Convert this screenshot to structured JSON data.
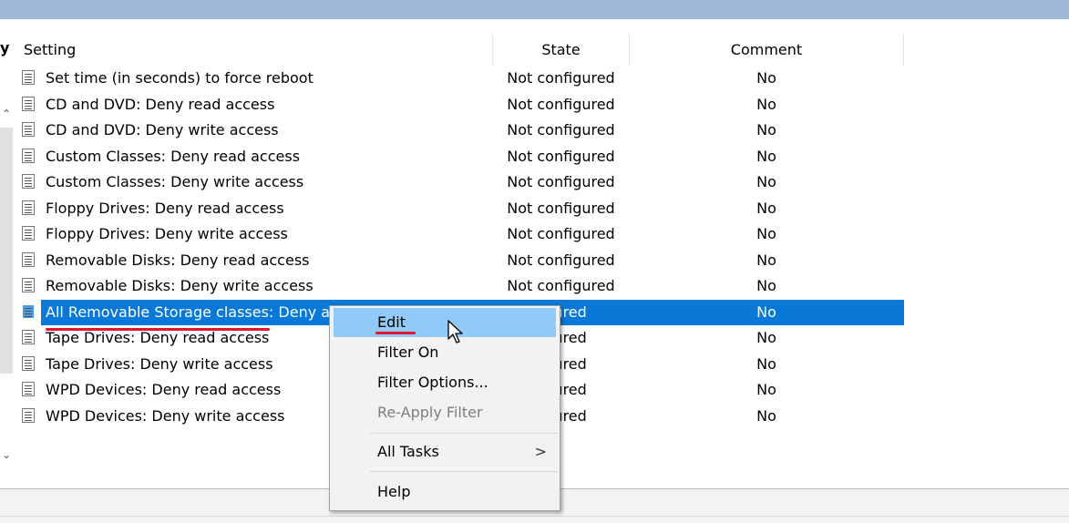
{
  "left_panel": {
    "partial_label": "y"
  },
  "columns": {
    "setting": "Setting",
    "state": "State",
    "comment": "Comment"
  },
  "rows": [
    {
      "setting": "Set time (in seconds) to force reboot",
      "state": "Not configured",
      "comment": "No"
    },
    {
      "setting": "CD and DVD: Deny read access",
      "state": "Not configured",
      "comment": "No"
    },
    {
      "setting": "CD and DVD: Deny write access",
      "state": "Not configured",
      "comment": "No"
    },
    {
      "setting": "Custom Classes: Deny read access",
      "state": "Not configured",
      "comment": "No"
    },
    {
      "setting": "Custom Classes: Deny write access",
      "state": "Not configured",
      "comment": "No"
    },
    {
      "setting": "Floppy Drives: Deny read access",
      "state": "Not configured",
      "comment": "No"
    },
    {
      "setting": "Floppy Drives: Deny write access",
      "state": "Not configured",
      "comment": "No"
    },
    {
      "setting": "Removable Disks: Deny read access",
      "state": "Not configured",
      "comment": "No"
    },
    {
      "setting": "Removable Disks: Deny write access",
      "state": "Not configured",
      "comment": "No"
    },
    {
      "setting": "All Removable Storage classes: Deny all",
      "state": "figured",
      "comment": "No",
      "selected": true
    },
    {
      "setting": "Tape Drives: Deny read access",
      "state": "figured",
      "comment": "No"
    },
    {
      "setting": "Tape Drives: Deny write access",
      "state": "figured",
      "comment": "No"
    },
    {
      "setting": "WPD Devices: Deny read access",
      "state": "figured",
      "comment": "No"
    },
    {
      "setting": "WPD Devices: Deny write access",
      "state": "figured",
      "comment": "No"
    }
  ],
  "context_menu": {
    "edit": "Edit",
    "filter_on": "Filter On",
    "filter_options": "Filter Options...",
    "reapply_filter": "Re-Apply Filter",
    "all_tasks": "All Tasks",
    "all_tasks_arrow": ">",
    "help": "Help"
  },
  "colors": {
    "selection": "#0a78d7",
    "menu_hover": "#91c9f7",
    "annotation": "#e4142c"
  }
}
